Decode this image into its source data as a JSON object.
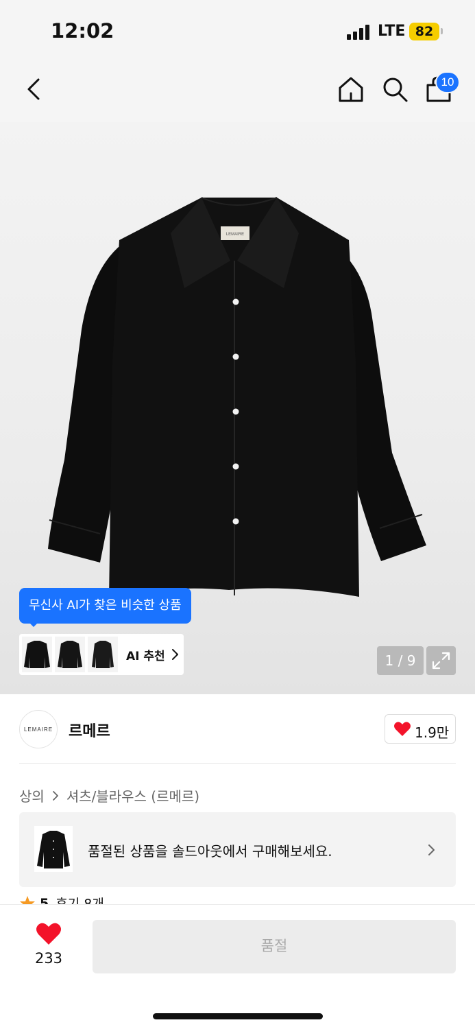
{
  "status_bar": {
    "time": "12:02",
    "network": "LTE",
    "battery": "82"
  },
  "nav": {
    "back_icon": "chevron-left-icon",
    "home_icon": "home-icon",
    "search_icon": "search-icon",
    "cart_icon": "shopping-bag-icon",
    "cart_count": "10"
  },
  "gallery": {
    "ai_tooltip": "무신사 AI가 찾은 비슷한 상품",
    "ai_recommend_label": "AI 추천",
    "page_counter": "1 / 9",
    "expand_icon": "expand-icon",
    "product_label_text": "LEMAIRE"
  },
  "brand": {
    "logo_text": "LEMAIRE",
    "name": "르메르",
    "like_count": "1.9만"
  },
  "breadcrumb": {
    "items": [
      "상의",
      "셔츠/블라우스 (르메르)"
    ]
  },
  "soldout_banner": {
    "text": "품절된 상품을 솔드아웃에서 구매해보세요."
  },
  "review": {
    "rating": "5",
    "review_text": "후기 8개"
  },
  "bottom_bar": {
    "wish_count": "233",
    "action_label": "품절"
  },
  "colors": {
    "accent_blue": "#1a73ff",
    "heart_red": "#f3132a",
    "battery_yellow": "#f6cd00",
    "star_orange": "#f59a23"
  }
}
